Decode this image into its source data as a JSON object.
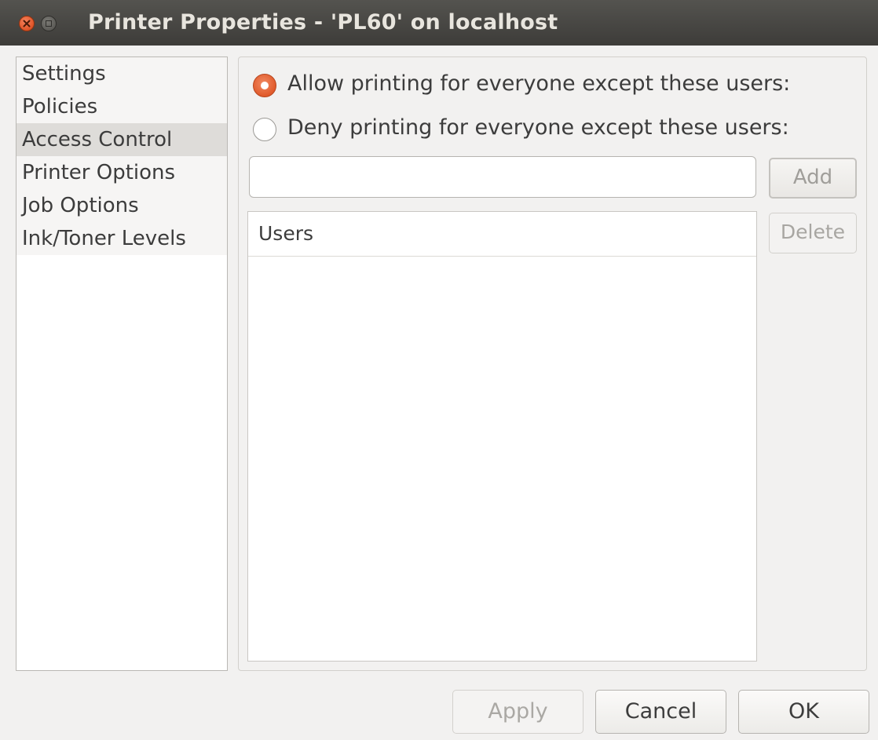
{
  "window": {
    "title": "Printer Properties - 'PL60' on localhost"
  },
  "sidebar": {
    "items": [
      {
        "label": "Settings"
      },
      {
        "label": "Policies"
      },
      {
        "label": "Access Control",
        "selected": true
      },
      {
        "label": "Printer Options"
      },
      {
        "label": "Job Options"
      },
      {
        "label": "Ink/Toner Levels"
      }
    ]
  },
  "access_control": {
    "allow_label": "Allow printing for everyone except these users:",
    "deny_label": "Deny printing for everyone except these users:",
    "selected_mode": "allow",
    "user_input_value": "",
    "add_label": "Add",
    "delete_label": "Delete",
    "users_column_header": "Users",
    "users": []
  },
  "footer": {
    "apply_label": "Apply",
    "cancel_label": "Cancel",
    "ok_label": "OK"
  },
  "colors": {
    "accent": "#e15a2b",
    "titlebar": "#3d3c39",
    "background": "#f2f1f0",
    "selected_row": "#dedcd9"
  },
  "icons": {
    "close": "close-icon",
    "maximize": "maximize-icon"
  }
}
